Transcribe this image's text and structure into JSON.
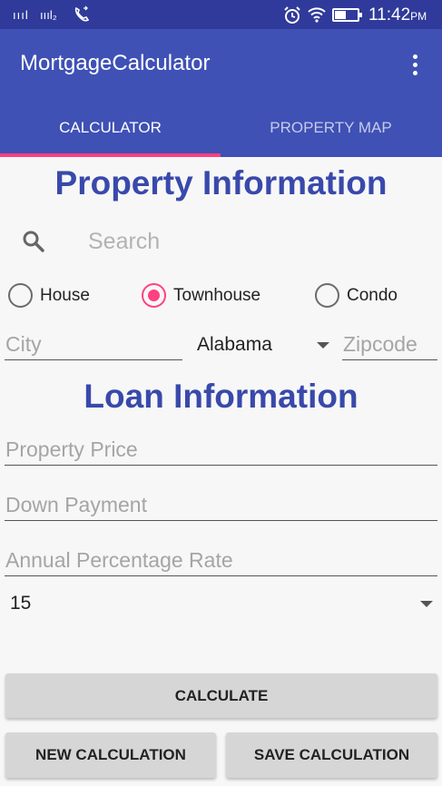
{
  "status_bar": {
    "signal1": "ıııl",
    "signal2": "ıııl₂",
    "time": "11:42",
    "ampm": "PM"
  },
  "app": {
    "title": "MortgageCalculator"
  },
  "tabs": [
    {
      "label": "CALCULATOR",
      "active": true
    },
    {
      "label": "PROPERTY MAP",
      "active": false
    }
  ],
  "property": {
    "heading": "Property Information",
    "search_placeholder": "Search",
    "types": [
      {
        "label": "House",
        "checked": false
      },
      {
        "label": "Townhouse",
        "checked": true
      },
      {
        "label": "Condo",
        "checked": false
      }
    ],
    "city_placeholder": "City",
    "state_value": "Alabama",
    "zip_placeholder": "Zipcode"
  },
  "loan": {
    "heading": "Loan Information",
    "price_placeholder": "Property Price",
    "down_placeholder": "Down Payment",
    "apr_placeholder": "Annual Percentage Rate",
    "term_value": "15"
  },
  "buttons": {
    "calculate": "CALCULATE",
    "new_calc": "NEW CALCULATION",
    "save_calc": "SAVE CALCULATION"
  },
  "colors": {
    "primary": "#3f51b5",
    "primary_dark": "#2f3a9a",
    "accent": "#ff4081",
    "heading": "#3949ab"
  }
}
